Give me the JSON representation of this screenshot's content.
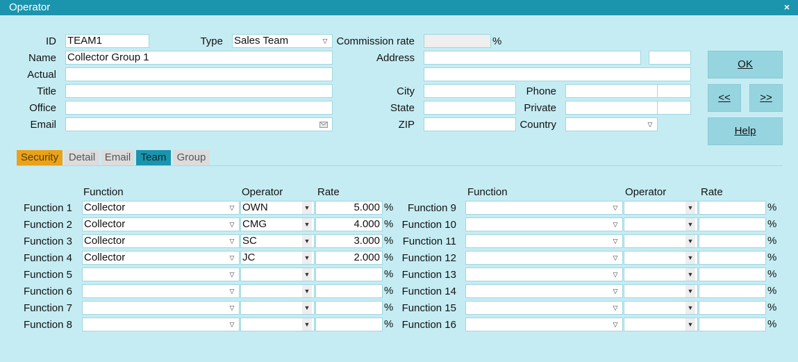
{
  "window": {
    "title": "Operator",
    "close_glyph": "×"
  },
  "header": {
    "id_label": "ID",
    "id_value": "TEAM1",
    "type_label": "Type",
    "type_value": "Sales Team",
    "commission_label": "Commission rate",
    "commission_value": "",
    "commission_unit": "%",
    "name_label": "Name",
    "name_value": "Collector Group 1",
    "actual_label": "Actual",
    "actual_value": "",
    "title_label": "Title",
    "title_value": "",
    "office_label": "Office",
    "office_value": "",
    "email_label": "Email",
    "email_value": "",
    "address_label": "Address",
    "address_line1": "",
    "address_extra": "",
    "address_line2": "",
    "city_label": "City",
    "city_value": "",
    "state_label": "State",
    "state_value": "",
    "zip_label": "ZIP",
    "zip_value": "",
    "phone_label": "Phone",
    "phone_value": "",
    "phone_ext": "",
    "private_label": "Private",
    "private_value": "",
    "private_ext": "",
    "country_label": "Country",
    "country_value": ""
  },
  "buttons": {
    "ok": "OK",
    "prev": "<<",
    "next": ">>",
    "help": "Help"
  },
  "tabs": [
    "Security",
    "Detail",
    "Email",
    "Team",
    "Group"
  ],
  "active_tab": "Team",
  "team_grid": {
    "col_function": "Function",
    "col_operator": "Operator",
    "col_rate": "Rate",
    "rate_unit": "%",
    "left_rows": [
      {
        "label": "Function 1",
        "function": "Collector",
        "operator": "OWN",
        "rate": "5.000"
      },
      {
        "label": "Function 2",
        "function": "Collector",
        "operator": "CMG",
        "rate": "4.000"
      },
      {
        "label": "Function 3",
        "function": "Collector",
        "operator": "SC",
        "rate": "3.000"
      },
      {
        "label": "Function 4",
        "function": "Collector",
        "operator": "JC",
        "rate": "2.000"
      },
      {
        "label": "Function 5",
        "function": "",
        "operator": "",
        "rate": ""
      },
      {
        "label": "Function 6",
        "function": "",
        "operator": "",
        "rate": ""
      },
      {
        "label": "Function 7",
        "function": "",
        "operator": "",
        "rate": ""
      },
      {
        "label": "Function 8",
        "function": "",
        "operator": "",
        "rate": ""
      }
    ],
    "right_rows": [
      {
        "label": "Function 9",
        "function": "",
        "operator": "",
        "rate": ""
      },
      {
        "label": "Function 10",
        "function": "",
        "operator": "",
        "rate": ""
      },
      {
        "label": "Function 11",
        "function": "",
        "operator": "",
        "rate": ""
      },
      {
        "label": "Function 12",
        "function": "",
        "operator": "",
        "rate": ""
      },
      {
        "label": "Function 13",
        "function": "",
        "operator": "",
        "rate": ""
      },
      {
        "label": "Function 14",
        "function": "",
        "operator": "",
        "rate": ""
      },
      {
        "label": "Function 15",
        "function": "",
        "operator": "",
        "rate": ""
      },
      {
        "label": "Function 16",
        "function": "",
        "operator": "",
        "rate": ""
      }
    ]
  },
  "colors": {
    "titlebar": "#1b94ad",
    "background": "#c6ecf3",
    "button": "#96d5e0",
    "security_tab": "#e9a21a",
    "active_tab": "#1b94ad"
  }
}
